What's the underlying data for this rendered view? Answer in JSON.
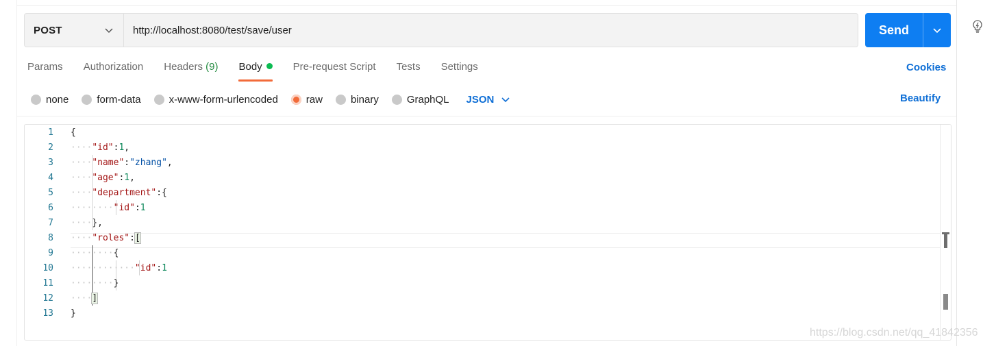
{
  "request": {
    "method": "POST",
    "url": "http://localhost:8080/test/save/user",
    "send_label": "Send"
  },
  "tabs": [
    {
      "label": "Params"
    },
    {
      "label": "Authorization"
    },
    {
      "label": "Headers",
      "count": "(9)"
    },
    {
      "label": "Body",
      "active": true
    },
    {
      "label": "Pre-request Script"
    },
    {
      "label": "Tests"
    },
    {
      "label": "Settings"
    }
  ],
  "cookies_label": "Cookies",
  "body_types": [
    {
      "label": "none"
    },
    {
      "label": "form-data"
    },
    {
      "label": "x-www-form-urlencoded"
    },
    {
      "label": "raw",
      "selected": true
    },
    {
      "label": "binary"
    },
    {
      "label": "GraphQL"
    }
  ],
  "body_language": "JSON",
  "beautify_label": "Beautify",
  "editor": {
    "line_numbers": [
      "1",
      "2",
      "3",
      "4",
      "5",
      "6",
      "7",
      "8",
      "9",
      "10",
      "11",
      "12",
      "13"
    ],
    "lines": [
      {
        "ws": "",
        "tokens": [
          {
            "t": "{",
            "c": "pun"
          }
        ]
      },
      {
        "ws": "····",
        "tokens": [
          {
            "t": "\"id\"",
            "c": "key"
          },
          {
            "t": ":",
            "c": "pun"
          },
          {
            "t": "1",
            "c": "num"
          },
          {
            "t": ",",
            "c": "pun"
          }
        ]
      },
      {
        "ws": "····",
        "tokens": [
          {
            "t": "\"name\"",
            "c": "key"
          },
          {
            "t": ":",
            "c": "pun"
          },
          {
            "t": "\"zhang\"",
            "c": "str"
          },
          {
            "t": ",",
            "c": "pun"
          }
        ]
      },
      {
        "ws": "····",
        "tokens": [
          {
            "t": "\"age\"",
            "c": "key"
          },
          {
            "t": ":",
            "c": "pun"
          },
          {
            "t": "1",
            "c": "num"
          },
          {
            "t": ",",
            "c": "pun"
          }
        ]
      },
      {
        "ws": "····",
        "tokens": [
          {
            "t": "\"department\"",
            "c": "key"
          },
          {
            "t": ":{",
            "c": "pun"
          }
        ]
      },
      {
        "ws": "········",
        "tokens": [
          {
            "t": "\"id\"",
            "c": "key"
          },
          {
            "t": ":",
            "c": "pun"
          },
          {
            "t": "1",
            "c": "num"
          }
        ]
      },
      {
        "ws": "····",
        "tokens": [
          {
            "t": "},",
            "c": "pun"
          }
        ]
      },
      {
        "ws": "····",
        "tokens": [
          {
            "t": "\"roles\"",
            "c": "key"
          },
          {
            "t": ":",
            "c": "pun"
          },
          {
            "t": "[",
            "c": "pun",
            "box": true
          }
        ]
      },
      {
        "ws": "········",
        "tokens": [
          {
            "t": "{",
            "c": "pun"
          }
        ]
      },
      {
        "ws": "············",
        "tokens": [
          {
            "t": "\"id\"",
            "c": "key"
          },
          {
            "t": ":",
            "c": "pun"
          },
          {
            "t": "1",
            "c": "num"
          }
        ]
      },
      {
        "ws": "········",
        "tokens": [
          {
            "t": "}",
            "c": "pun"
          }
        ]
      },
      {
        "ws": "····",
        "tokens": [
          {
            "t": "]",
            "c": "pun",
            "box": true
          }
        ]
      },
      {
        "ws": "",
        "tokens": [
          {
            "t": "}",
            "c": "pun"
          }
        ]
      }
    ]
  },
  "watermark": "https://blog.csdn.net/qq_41842356"
}
